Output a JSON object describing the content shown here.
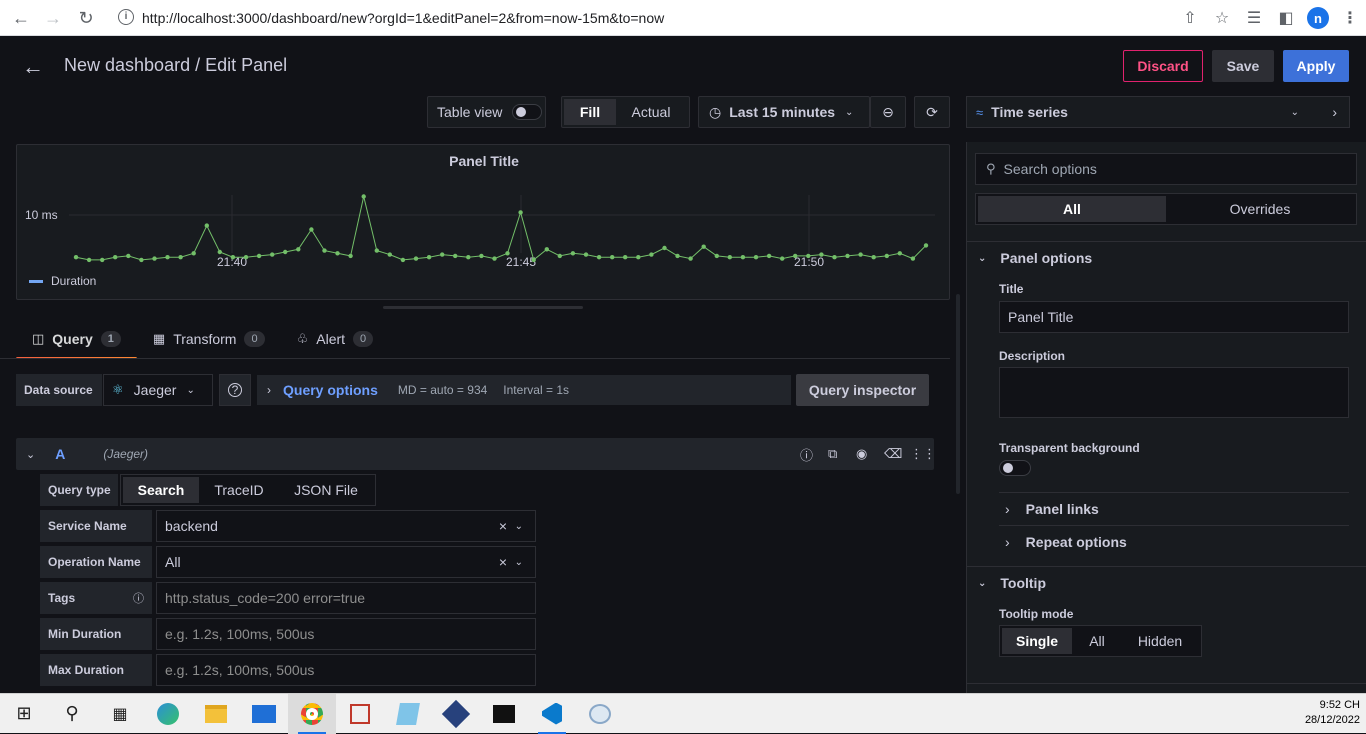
{
  "browser": {
    "url": "http://localhost:3000/dashboard/new?orgId=1&editPanel=2&from=now-15m&to=now",
    "avatar_letter": "n"
  },
  "header": {
    "title": "New dashboard / Edit Panel",
    "discard": "Discard",
    "save": "Save",
    "apply": "Apply"
  },
  "toolbar": {
    "table_view": "Table view",
    "fill": "Fill",
    "actual": "Actual",
    "time_range": "Last 15 minutes",
    "visualization": "Time series"
  },
  "panel": {
    "title": "Panel Title",
    "y_tick": "10 ms",
    "x_ticks": [
      "21:40",
      "21:45",
      "21:50"
    ],
    "legend": "Duration"
  },
  "chart_data": {
    "type": "line",
    "series": [
      {
        "name": "Duration",
        "color": "#73bf69",
        "values": [
          6.8,
          6.6,
          6.6,
          6.8,
          6.9,
          6.6,
          6.7,
          6.8,
          6.8,
          7.1,
          9.2,
          7.2,
          6.8,
          6.8,
          6.9,
          7.0,
          7.2,
          7.4,
          8.9,
          7.3,
          7.1,
          6.9,
          11.4,
          7.3,
          7.0,
          6.6,
          6.7,
          6.8,
          7.0,
          6.9,
          6.8,
          6.9,
          6.7,
          7.1,
          10.2,
          6.6,
          7.4,
          6.9,
          7.1,
          7.0,
          6.8,
          6.8,
          6.8,
          6.8,
          7.0,
          7.5,
          6.9,
          6.7,
          7.6,
          6.9,
          6.8,
          6.8,
          6.8,
          6.9,
          6.7,
          6.9,
          6.9,
          7.0,
          6.8,
          6.9,
          7.0,
          6.8,
          6.9,
          7.1,
          6.7,
          7.7
        ]
      }
    ],
    "x_tick_labels": [
      "21:40",
      "21:45",
      "21:50"
    ],
    "y_tick_labels": [
      "10 ms"
    ],
    "legend": "bottom-left"
  },
  "tabs": [
    {
      "label": "Query",
      "count": "1"
    },
    {
      "label": "Transform",
      "count": "0"
    },
    {
      "label": "Alert",
      "count": "0"
    }
  ],
  "datasource": {
    "label": "Data source",
    "value": "Jaeger",
    "query_options": "Query options",
    "md": "MD = auto = 934",
    "interval": "Interval = 1s",
    "inspector": "Query inspector"
  },
  "query": {
    "ref": "A",
    "ds_name": "(Jaeger)",
    "query_type_label": "Query type",
    "query_types": [
      "Search",
      "TraceID",
      "JSON File"
    ],
    "service_label": "Service Name",
    "service_value": "backend",
    "operation_label": "Operation Name",
    "operation_value": "All",
    "tags_label": "Tags",
    "tags_placeholder": "http.status_code=200 error=true",
    "min_label": "Min Duration",
    "min_placeholder": "e.g. 1.2s, 100ms, 500us",
    "max_label": "Max Duration",
    "max_placeholder": "e.g. 1.2s, 100ms, 500us"
  },
  "options": {
    "search_placeholder": "Search options",
    "all": "All",
    "overrides": "Overrides",
    "panel_options": "Panel options",
    "title_label": "Title",
    "title_value": "Panel Title",
    "description_label": "Description",
    "transparent_label": "Transparent background",
    "panel_links": "Panel links",
    "repeat_options": "Repeat options",
    "tooltip": "Tooltip",
    "tooltip_mode_label": "Tooltip mode",
    "tooltip_modes": [
      "Single",
      "All",
      "Hidden"
    ]
  },
  "taskbar": {
    "time": "9:52 CH",
    "date": "28/12/2022"
  }
}
